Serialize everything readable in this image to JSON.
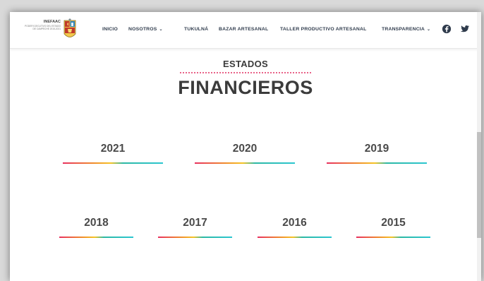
{
  "logo": {
    "title": "INEFAAC",
    "subtitle": "PODER EJECUTIVO DEL ESTADO DE CAMPECHE 2015-2021"
  },
  "nav": {
    "items": [
      {
        "label": "INICIO",
        "dropdown": false
      },
      {
        "label": "NOSOTROS",
        "dropdown": true
      },
      {
        "label": "TUKULNÁ",
        "dropdown": false
      },
      {
        "label": "BAZAR ARTESANAL",
        "dropdown": false
      },
      {
        "label": "TALLER PRODUCTIVO ARTESANAL",
        "dropdown": false
      },
      {
        "label": "TRANSPARENCIA",
        "dropdown": true
      }
    ],
    "chevron": "⌄",
    "social": [
      "facebook-icon",
      "twitter-icon"
    ]
  },
  "heading": {
    "eyebrow": "ESTADOS",
    "title": "FINANCIEROS"
  },
  "years": [
    "2021",
    "2020",
    "2019",
    "2018",
    "2017",
    "2016",
    "2015"
  ],
  "colors": {
    "text": "#3b3b3b",
    "nav": "#2f3b4c",
    "accent_pink": "#e8305f",
    "accent_teal": "#2bc6d0"
  }
}
